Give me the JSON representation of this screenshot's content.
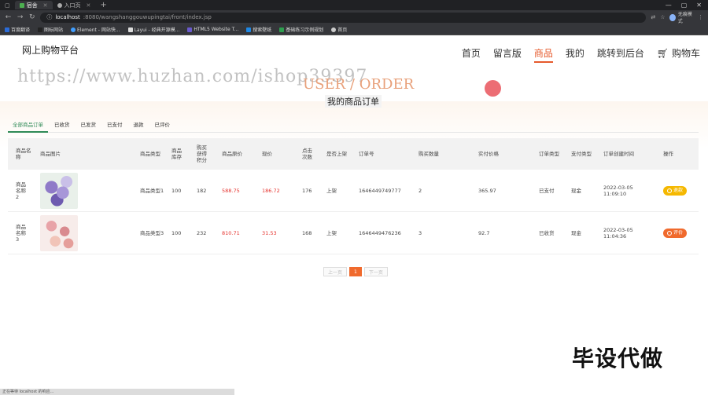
{
  "browser": {
    "tabs": [
      {
        "label": "宿舍",
        "active": true
      },
      {
        "label": "入口页",
        "active": false
      }
    ],
    "new_tab": "+",
    "url_host": "localhost",
    "url_path": ":8080/wangshanggouwupingtai/front/index.jsp",
    "profile_label": "无痕模式",
    "bookmarks": [
      "百度翻译",
      "图标网站",
      "Element - 网站快...",
      "Layui - 经典开源模...",
      "HTML5 Website T...",
      "搜索壁纸",
      "基础练习示例规划",
      "首页"
    ]
  },
  "site": {
    "brand": "网上购物平台",
    "nav": [
      "首页",
      "留言版",
      "商品",
      "我的",
      "跳转到后台",
      "购物车"
    ]
  },
  "watermark": "https://www.huzhan.com/ishop39397",
  "section": {
    "title_en": "USER / ORDER",
    "title_cn": "我的商品订单"
  },
  "subtabs": [
    "全部商品订单",
    "已收货",
    "已发货",
    "已支付",
    "退款",
    "已评价"
  ],
  "table": {
    "headers": [
      "商品名称",
      "商品图片",
      "商品类型",
      "商品库存",
      "购买获得积分",
      "商品原价",
      "现价",
      "点击次数",
      "是否上架",
      "订单号",
      "购买数量",
      "实付价格",
      "订单类型",
      "支付类型",
      "订单创建时间",
      "操作"
    ],
    "rows": [
      {
        "name": "商品名称2",
        "type": "商品类型1",
        "stock": "100",
        "points": "182",
        "orig_price": "588.75",
        "price": "186.72",
        "clicks": "176",
        "listed": "上架",
        "order_no": "1646449749777",
        "qty": "2",
        "paid": "365.97",
        "order_type": "已支付",
        "pay_type": "现金",
        "created_date": "2022-03-05",
        "created_time": "11:09:10",
        "action": "退款"
      },
      {
        "name": "商品名称3",
        "type": "商品类型3",
        "stock": "100",
        "points": "232",
        "orig_price": "810.71",
        "price": "31.53",
        "clicks": "168",
        "listed": "上架",
        "order_no": "1646449476236",
        "qty": "3",
        "paid": "92.7",
        "order_type": "已收货",
        "pay_type": "现金",
        "created_date": "2022-03-05",
        "created_time": "11:04:36",
        "action": "评价"
      }
    ]
  },
  "pager": {
    "prev": "上一页",
    "current": "1",
    "next": "下一页"
  },
  "overlay_text": "毕设代做",
  "status_bar": "正在等待 localhost 的响应..."
}
